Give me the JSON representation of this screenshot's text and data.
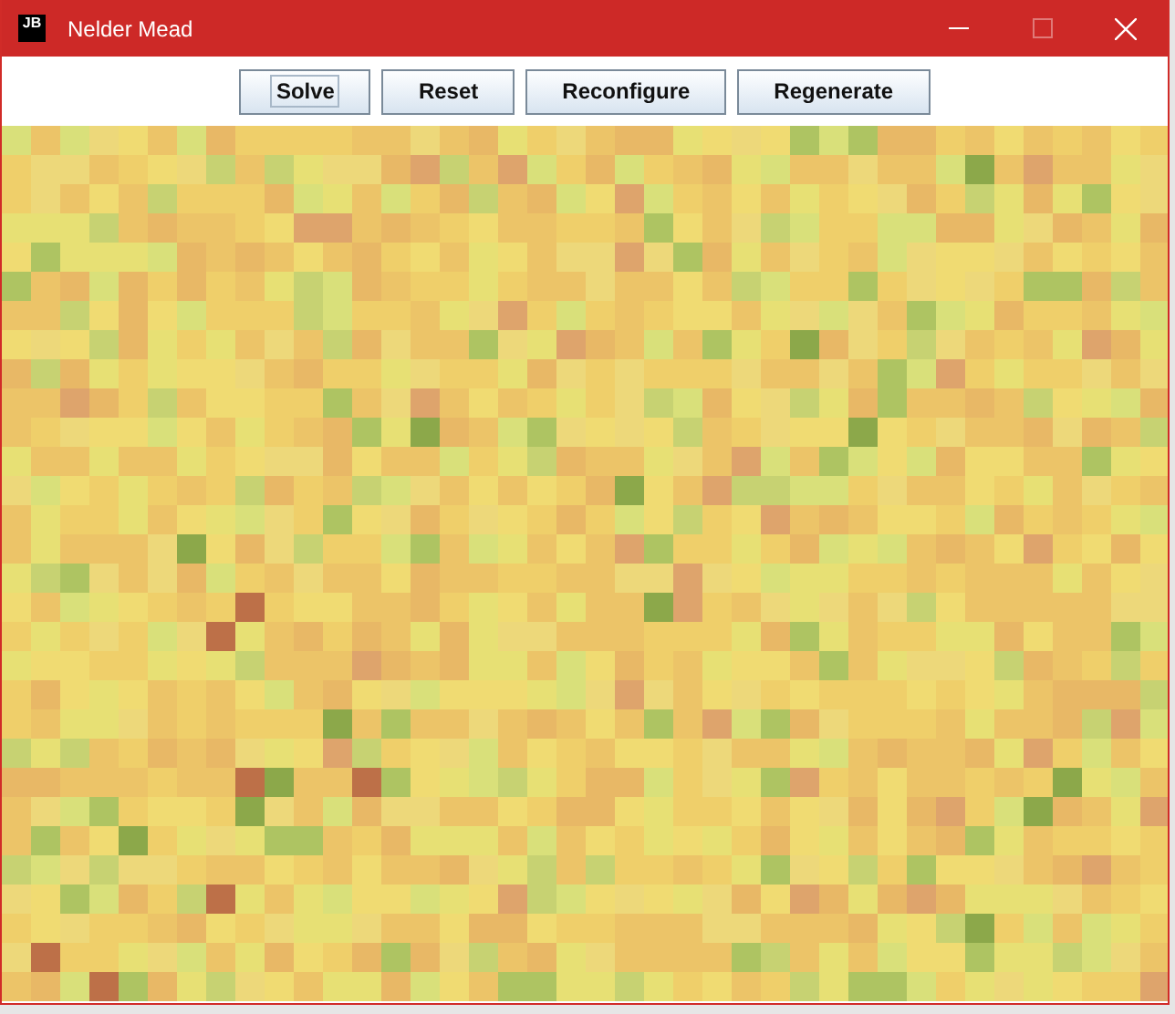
{
  "window": {
    "title": "Nelder Mead",
    "icon_label": "JB",
    "controls": [
      {
        "kind": "minimize",
        "disabled": false
      },
      {
        "kind": "maximize",
        "disabled": true
      },
      {
        "kind": "close",
        "disabled": false
      }
    ]
  },
  "buttons": [
    {
      "label": "Solve",
      "focused": true
    },
    {
      "label": "Reset",
      "focused": false
    },
    {
      "label": "Reconfigure",
      "focused": false
    },
    {
      "label": "Regenerate",
      "focused": false
    }
  ]
}
